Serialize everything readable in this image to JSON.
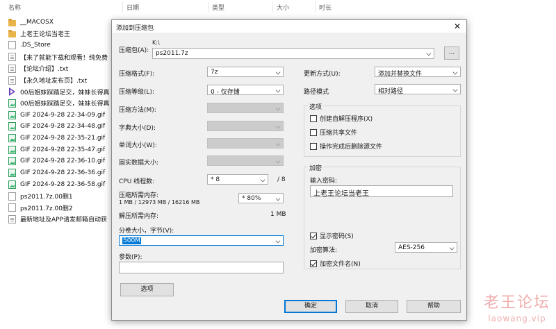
{
  "explorer": {
    "columns": {
      "name": "名称",
      "date": "日期",
      "type": "类型",
      "size": "大小",
      "duration": "时长"
    },
    "files": [
      {
        "name": "__MACOSX",
        "icon": "folder-icon"
      },
      {
        "name": "上老王论坛当老王",
        "icon": "folder-icon"
      },
      {
        "name": ".DS_Store",
        "icon": "file-icon"
      },
      {
        "name": "【来了就能下载和观看！纯免费",
        "icon": "text-file-icon"
      },
      {
        "name": "【论坛介绍】.txt",
        "icon": "text-file-icon"
      },
      {
        "name": "【永久地址发布页】.txt",
        "icon": "text-file-icon"
      },
      {
        "name": "00后姐妹踩踏足交，妹妹长得真",
        "icon": "video-file-icon"
      },
      {
        "name": "00后姐妹踩踏足交，妹妹长得真",
        "icon": "image-file-icon"
      },
      {
        "name": "GIF 2024-9-28 22-34-09.gif",
        "icon": "image-file-icon"
      },
      {
        "name": "GIF 2024-9-28 22-34-48.gif",
        "icon": "image-file-icon"
      },
      {
        "name": "GIF 2024-9-28 22-35-21.gif",
        "icon": "image-file-icon"
      },
      {
        "name": "GIF 2024-9-28 22-35-47.gif",
        "icon": "image-file-icon"
      },
      {
        "name": "GIF 2024-9-28 22-36-10.gif",
        "icon": "image-file-icon"
      },
      {
        "name": "GIF 2024-9-28 22-36-36.gif",
        "icon": "image-file-icon"
      },
      {
        "name": "GIF 2024-9-28 22-36-58.gif",
        "icon": "image-file-icon"
      },
      {
        "name": "ps2011.7z.00删1",
        "icon": "file-icon"
      },
      {
        "name": "ps2011.7z.00删2",
        "icon": "file-icon"
      },
      {
        "name": "最新地址及APP请发邮箱自动获",
        "icon": "text-file-icon"
      }
    ]
  },
  "watermark": {
    "logo": "老王论坛",
    "url": "laowang.vip",
    "color": "#e46a6a"
  },
  "dialog": {
    "title": "添加到压缩包",
    "archive": {
      "label": "压缩包(A):",
      "path": "K:\\",
      "value": "ps2011.7z",
      "browse": "..."
    },
    "format": {
      "label": "压缩格式(F):",
      "value": "7z"
    },
    "level": {
      "label": "压缩等级(L):",
      "value": "0 - 仅存储"
    },
    "method": {
      "label": "压缩方法(M):",
      "value": ""
    },
    "dict": {
      "label": "字典大小(D):",
      "value": ""
    },
    "word": {
      "label": "单词大小(W):",
      "value": ""
    },
    "solid": {
      "label": "固实数据大小:",
      "value": ""
    },
    "threads": {
      "label": "CPU 线程数:",
      "value": "* 8",
      "max": "/ 8"
    },
    "mem_compress": {
      "label": "压缩所需内存:",
      "detail": "1 MB / 12973 MB / 16216 MB",
      "value": "* 80%"
    },
    "mem_decompress": {
      "label": "解压所需内存:",
      "value": "1 MB"
    },
    "split": {
      "label": "分卷大小，字节(V):",
      "value": "500M"
    },
    "params": {
      "label": "参数(P):",
      "value": ""
    },
    "options_btn": "选项",
    "update": {
      "label": "更新方式(U):",
      "value": "添加并替换文件"
    },
    "path_mode": {
      "label": "路径模式",
      "value": "相对路径"
    },
    "options_group": {
      "title": "选项",
      "items": [
        {
          "label": "创建自解压程序(X)",
          "checked": false
        },
        {
          "label": "压缩共享文件",
          "checked": false
        },
        {
          "label": "操作完成后删除源文件",
          "checked": false
        }
      ]
    },
    "encryption": {
      "title": "加密",
      "password_label": "输入密码:",
      "password_value": "上老王论坛当老王",
      "show_password": {
        "label": "显示密码(S)",
        "checked": true
      },
      "method_label": "加密算法:",
      "method_value": "AES-256",
      "encrypt_names": {
        "label": "加密文件名(N)",
        "checked": true
      }
    },
    "buttons": {
      "ok": "确定",
      "cancel": "取消",
      "help": "帮助"
    },
    "accent_color": "#0078d7"
  }
}
